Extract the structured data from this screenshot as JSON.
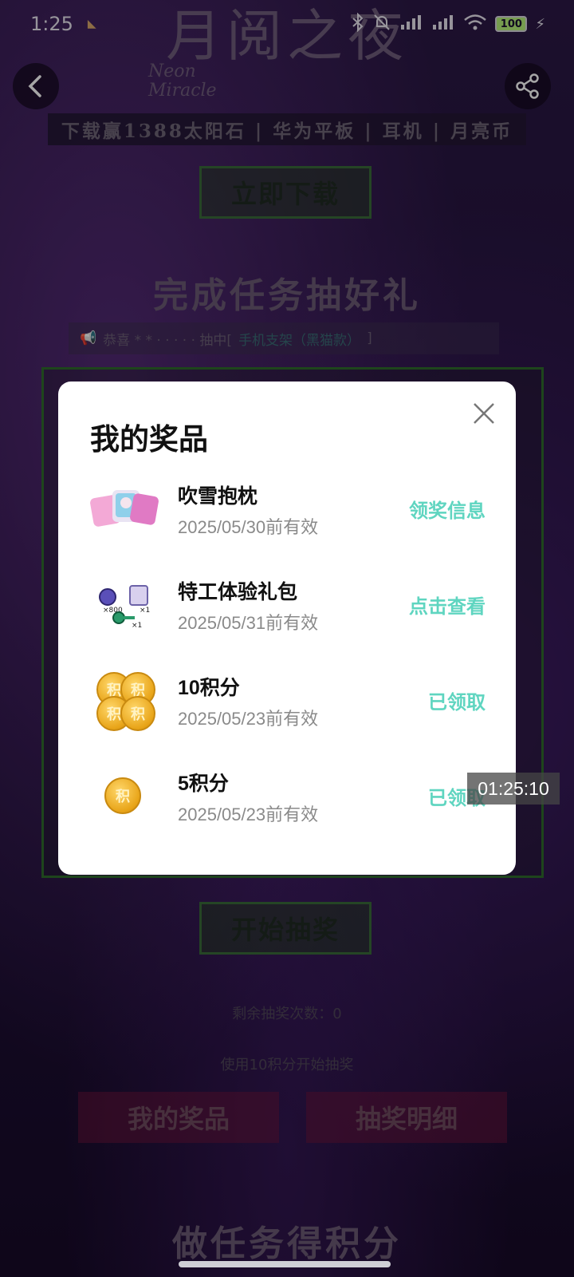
{
  "status_bar": {
    "time": "1:25",
    "battery": "100"
  },
  "background": {
    "logo_title": "月阅之夜",
    "logo_subtitle_line1": "Neon",
    "logo_subtitle_line2": "Miracle",
    "promo_banner": "下载赢1388太阳石 | 华为平板 | 耳机 | 月亮币",
    "download_button": "立即下载",
    "section_lottery_title": "完成任务抽好礼",
    "ticker_prefix": "恭喜 * * · · · · · 抽中[",
    "ticker_prize": "手机支架（黑猫款）",
    "ticker_suffix": "]",
    "start_draw_button": "开始抽奖",
    "remaining_draws": "剩余抽奖次数：0",
    "use_points_hint": "使用10积分开始抽奖",
    "my_prizes_button": "我的奖品",
    "draw_details_button": "抽奖明细",
    "section_tasks_title": "做任务得积分"
  },
  "modal": {
    "title": "我的奖品",
    "prizes": [
      {
        "name": "吹雪抱枕",
        "date": "2025/05/30前有效",
        "action": "领奖信息",
        "icon": "pillow-image"
      },
      {
        "name": "特工体验礼包",
        "date": "2025/05/31前有效",
        "action": "点击查看",
        "icon": "gift-pack-image"
      },
      {
        "name": "10积分",
        "date": "2025/05/23前有效",
        "action": "已领取",
        "icon": "points-coins-image"
      },
      {
        "name": "5积分",
        "date": "2025/05/23前有效",
        "action": "已领取",
        "icon": "points-coin-image"
      }
    ],
    "gift_pack_labels": {
      "x800": "×800",
      "x1a": "×1",
      "x1b": "×1"
    },
    "coin_char": "积"
  },
  "timer": "01:25:10",
  "colors": {
    "accent": "#5fd5c0",
    "modal_bg": "#ffffff"
  }
}
